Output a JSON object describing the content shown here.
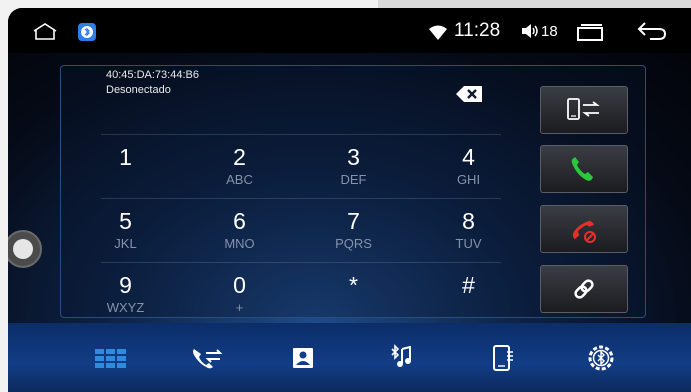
{
  "status_bar": {
    "time": "11:28",
    "volume": "18",
    "icons": [
      "home-icon",
      "bluetooth-notification-icon",
      "wifi-icon",
      "volume-icon",
      "recent-apps-icon",
      "back-icon"
    ]
  },
  "device": {
    "address": "40:45:DA:73:44:B6",
    "status": "Desonectado"
  },
  "keypad": [
    {
      "digit": "1",
      "letters": ""
    },
    {
      "digit": "2",
      "letters": "ABC"
    },
    {
      "digit": "3",
      "letters": "DEF"
    },
    {
      "digit": "4",
      "letters": "GHI"
    },
    {
      "digit": "5",
      "letters": "JKL"
    },
    {
      "digit": "6",
      "letters": "MNO"
    },
    {
      "digit": "7",
      "letters": "PQRS"
    },
    {
      "digit": "8",
      "letters": "TUV"
    },
    {
      "digit": "9",
      "letters": "WXYZ"
    },
    {
      "digit": "0",
      "letters": "+"
    },
    {
      "digit": "*",
      "letters": ""
    },
    {
      "digit": "#",
      "letters": ""
    }
  ],
  "side_buttons": [
    "transfer-call-icon",
    "call-icon",
    "hang-up-icon",
    "link-icon"
  ],
  "bottom_nav": [
    "dialpad-icon",
    "call-log-icon",
    "contacts-icon",
    "bt-music-icon",
    "phone-device-icon",
    "bluetooth-settings-icon"
  ],
  "colors": {
    "call_green": "#29c93a",
    "hangup_red": "#e5302a",
    "nav_blue": "#2e8be0",
    "bluetooth_badge": "#2f7ee8"
  }
}
